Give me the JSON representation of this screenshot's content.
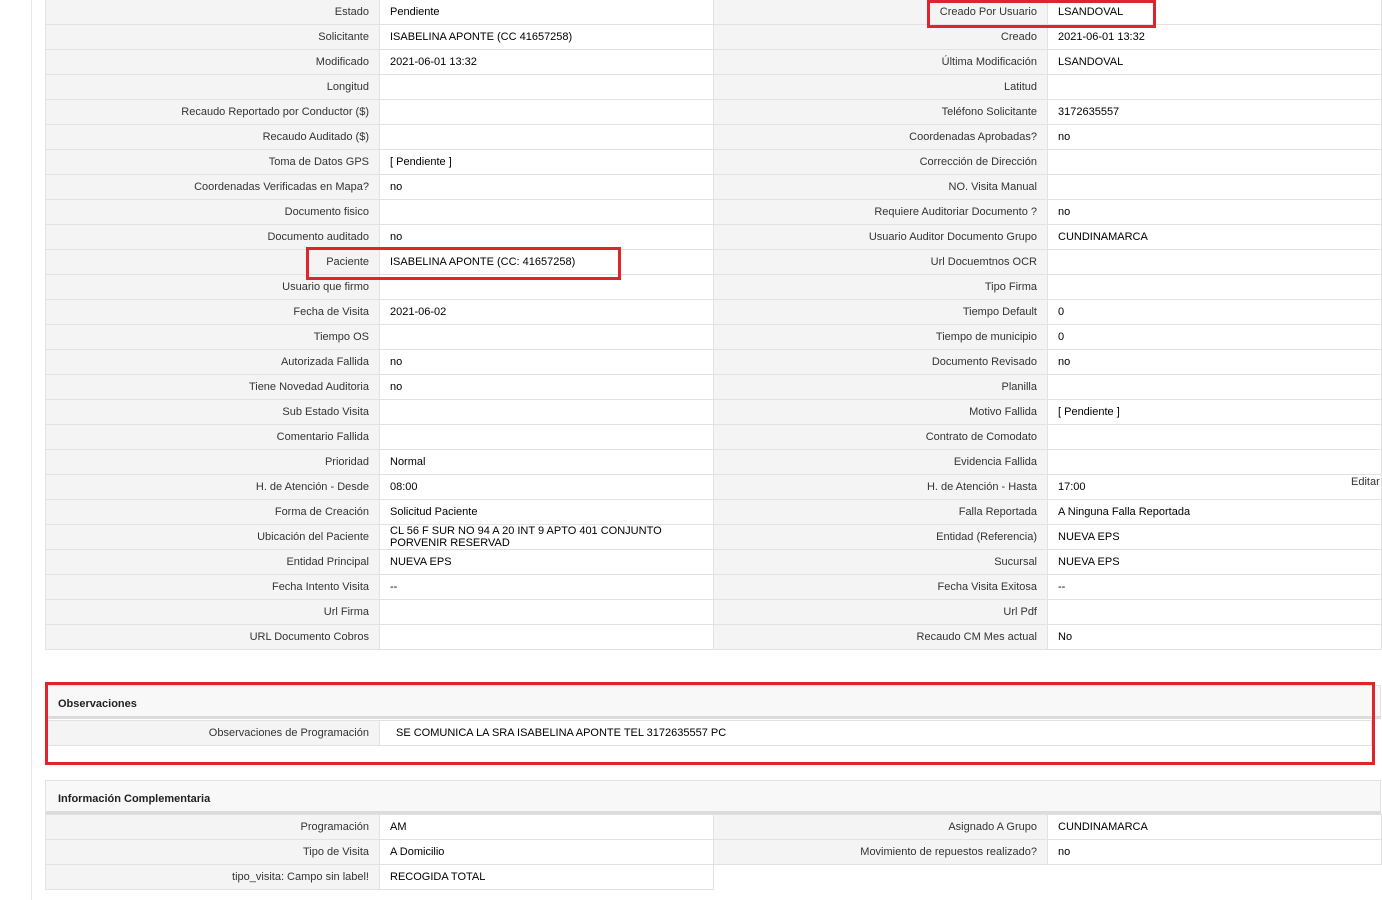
{
  "colors": {
    "label_bg": "#f4f4f4",
    "border": "#e2e2e2",
    "highlight": "#e0232d"
  },
  "main_rows": [
    {
      "l1": "Estado",
      "v1": "Pendiente",
      "l2": "Creado Por Usuario",
      "v2": "LSANDOVAL"
    },
    {
      "l1": "Solicitante",
      "v1": "ISABELINA APONTE (CC 41657258)",
      "l2": "Creado",
      "v2": "2021-06-01 13:32"
    },
    {
      "l1": "Modificado",
      "v1": "2021-06-01 13:32",
      "l2": "Última Modificación",
      "v2": " LSANDOVAL"
    },
    {
      "l1": "Longitud",
      "v1": "",
      "l2": "Latitud",
      "v2": ""
    },
    {
      "l1": "Recaudo Reportado por Conductor ($)",
      "v1": "",
      "l2": "Teléfono Solicitante",
      "v2": "3172635557"
    },
    {
      "l1": "Recaudo Auditado ($)",
      "v1": "",
      "l2": "Coordenadas Aprobadas?",
      "v2": " no"
    },
    {
      "l1": "Toma de Datos GPS",
      "v1": "[ Pendiente ]",
      "l2": "Corrección de Dirección",
      "v2": ""
    },
    {
      "l1": "Coordenadas Verificadas en Mapa?",
      "v1": " no",
      "l2": "NO. Visita Manual",
      "v2": ""
    },
    {
      "l1": "Documento fisico",
      "v1": "",
      "l2": "Requiere Auditoriar Documento ?",
      "v2": " no"
    },
    {
      "l1": "Documento auditado",
      "v1": " no",
      "l2": "Usuario Auditor Documento Grupo",
      "v2": "CUNDINAMARCA"
    },
    {
      "l1": "Paciente",
      "v1": "ISABELINA APONTE (CC: 41657258)",
      "l2": "Url Docuemtnos OCR",
      "v2": ""
    },
    {
      "l1": "Usuario que firmo",
      "v1": "",
      "l2": "Tipo Firma",
      "v2": ""
    },
    {
      "l1": "Fecha de Visita",
      "v1": " 2021-06-02",
      "l2": "Tiempo Default",
      "v2": "0"
    },
    {
      "l1": "Tiempo OS",
      "v1": "",
      "l2": "Tiempo de municipio",
      "v2": "0"
    },
    {
      "l1": "Autorizada Fallida",
      "v1": " no",
      "l2": "Documento Revisado",
      "v2": " no"
    },
    {
      "l1": "Tiene Novedad Auditoria",
      "v1": " no",
      "l2": "Planilla",
      "v2": ""
    },
    {
      "l1": "Sub Estado Visita",
      "v1": "",
      "l2": "Motivo Fallida",
      "v2": "[ Pendiente ]"
    },
    {
      "l1": "Comentario Fallida",
      "v1": "",
      "l2": "Contrato de Comodato",
      "v2": ""
    },
    {
      "l1": "Prioridad",
      "v1": "Normal",
      "l2": "Evidencia Fallida",
      "v2": ""
    },
    {
      "l1": "H. de Atención - Desde",
      "v1": "08:00",
      "l2": "H. de Atención - Hasta",
      "v2": "17:00"
    },
    {
      "l1": "Forma de Creación",
      "v1": "Solicitud Paciente",
      "l2": "Falla Reportada",
      "v2": "A Ninguna Falla Reportada"
    },
    {
      "l1": "Ubicación del Paciente",
      "v1": "CL 56 F SUR NO 94 A 20 INT 9 APTO 401 CONJUNTO PORVENIR RESERVAD",
      "l2": "Entidad (Referencia)",
      "v2": "NUEVA EPS"
    },
    {
      "l1": "Entidad Principal",
      "v1": "NUEVA EPS",
      "l2": "Sucursal",
      "v2": "NUEVA EPS"
    },
    {
      "l1": "Fecha Intento Visita",
      "v1": " --",
      "l2": "Fecha Visita Exitosa",
      "v2": " --"
    },
    {
      "l1": "Url Firma",
      "v1": "",
      "l2": "Url Pdf",
      "v2": ""
    },
    {
      "l1": "URL Documento Cobros",
      "v1": "",
      "l2": "Recaudo CM Mes actual",
      "v2": "No"
    }
  ],
  "edit_label": "Editar",
  "observaciones": {
    "title": "Observaciones",
    "label": "Observaciones de Programación",
    "value": "SE COMUNICA LA SRA ISABELINA APONTE TEL 3172635557 PC"
  },
  "complementaria": {
    "title": "Información Complementaria",
    "rows": [
      {
        "l1": "Programación",
        "v1": "AM",
        "l2": "Asignado A Grupo",
        "v2": "CUNDINAMARCA"
      },
      {
        "l1": "Tipo de Visita",
        "v1": "A Domicilio",
        "l2": "Movimiento de repuestos realizado?",
        "v2": " no"
      },
      {
        "l1": "tipo_visita: Campo sin label!",
        "v1": "RECOGIDA TOTAL",
        "l2": "",
        "v2": ""
      }
    ]
  }
}
